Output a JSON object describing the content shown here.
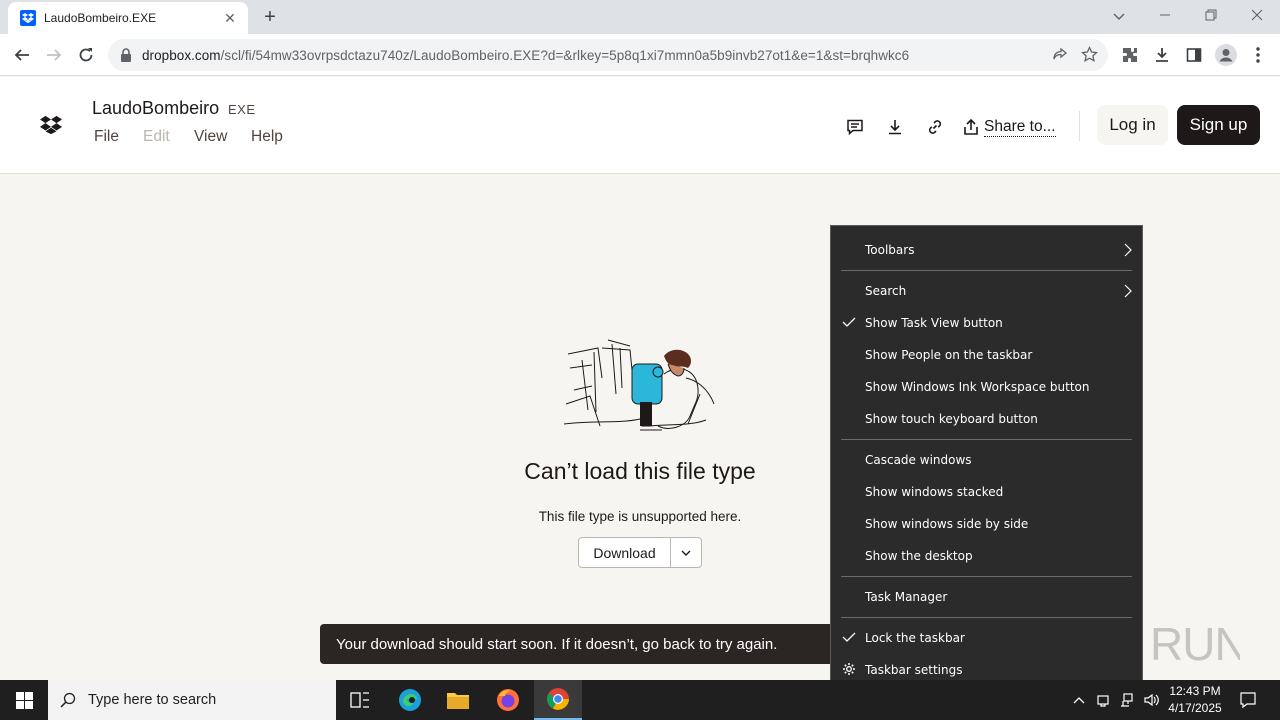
{
  "browser": {
    "tab_title": "LaudoBombeiro.EXE",
    "url_host": "dropbox.com",
    "url_path": "/scl/fi/54mw33ovrpsdctazu740z/LaudoBombeiro.EXE?d=&rlkey=5p8q1xi7mmn0a5b9invb27ot1&e=1&st=brqhwkc6"
  },
  "header": {
    "file_name": "LaudoBombeiro",
    "file_ext": "EXE",
    "menu": [
      "File",
      "Edit",
      "View",
      "Help"
    ],
    "share_label": "Share to...",
    "login_label": "Log in",
    "signup_label": "Sign up"
  },
  "main": {
    "error_title": "Can’t load this file type",
    "error_subtitle": "This file type is unsupported here.",
    "download_label": "Download",
    "toast": "Your download should start soon. If it doesn’t, go back to try again."
  },
  "context_menu": {
    "items": [
      {
        "label": "Toolbars",
        "submenu": true
      },
      {
        "label": "Search",
        "submenu": true
      },
      {
        "label": "Show Task View button",
        "checked": true
      },
      {
        "label": "Show People on the taskbar"
      },
      {
        "label": "Show Windows Ink Workspace button"
      },
      {
        "label": "Show touch keyboard button"
      },
      {
        "label": "Cascade windows"
      },
      {
        "label": "Show windows stacked"
      },
      {
        "label": "Show windows side by side"
      },
      {
        "label": "Show the desktop"
      },
      {
        "label": "Task Manager"
      },
      {
        "label": "Lock the taskbar",
        "checked": true
      },
      {
        "label": "Taskbar settings",
        "icon": "gear-icon"
      }
    ]
  },
  "watermark": "ANY RUN",
  "taskbar": {
    "search_placeholder": "Type here to search",
    "time": "12:43 PM",
    "date": "4/17/2025"
  },
  "colors": {
    "dropbox_blue": "#0061fe",
    "taskbar_bg": "#1f1f1f",
    "menu_bg": "#2b2b2b",
    "page_bg": "#f7f5f2"
  }
}
